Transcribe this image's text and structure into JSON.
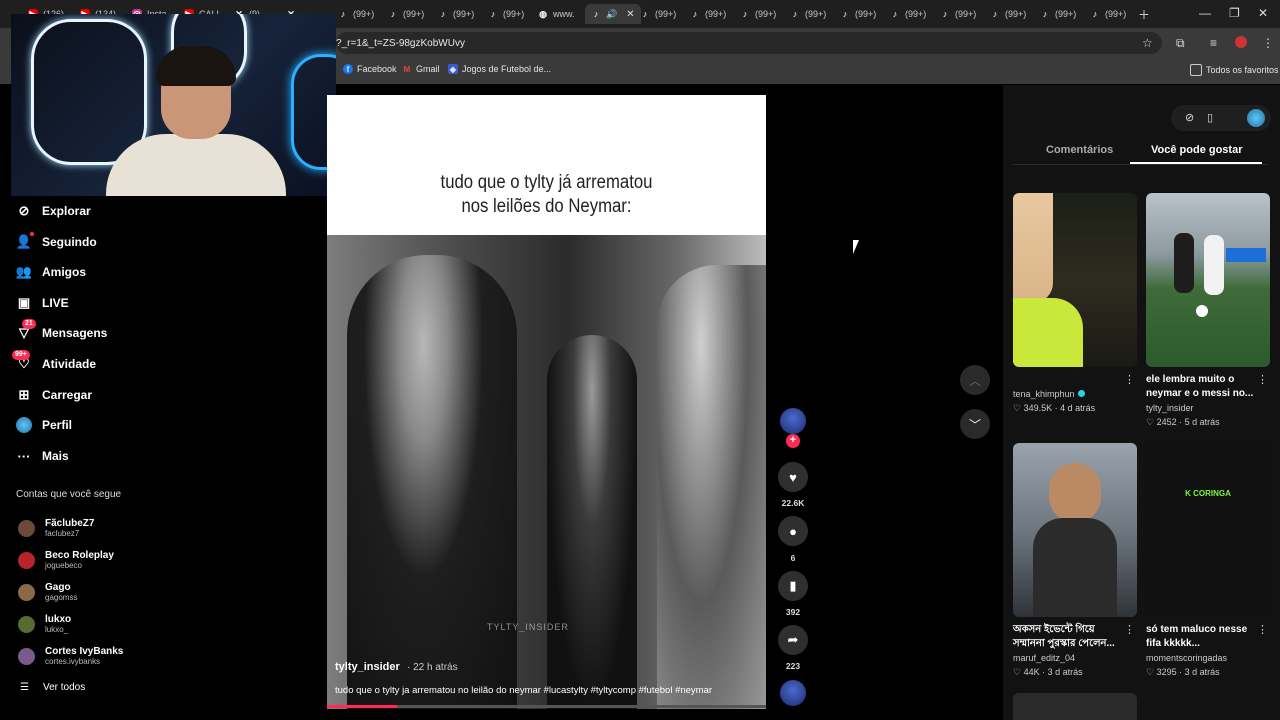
{
  "browser": {
    "tabs": [
      {
        "label": "(126)",
        "icon": "youtube-icon"
      },
      {
        "label": "(134)",
        "icon": "youtube-icon"
      },
      {
        "label": "Insta",
        "icon": "instagram-icon"
      },
      {
        "label": "CALL",
        "icon": "youtube-icon"
      },
      {
        "label": "(9)",
        "icon": "x-icon"
      },
      {
        "label": "(99+)",
        "icon": "tiktok-icon"
      },
      {
        "label": "(99+)",
        "icon": "tiktok-icon"
      },
      {
        "label": "(99+)",
        "icon": "tiktok-icon"
      },
      {
        "label": "(99+)",
        "icon": "tiktok-icon"
      },
      {
        "label": "www.",
        "icon": "globe-icon"
      },
      {
        "label": "(99+)",
        "icon": "tiktok-icon"
      },
      {
        "label": "(99+)",
        "icon": "tiktok-icon"
      },
      {
        "label": "(99+)",
        "icon": "tiktok-icon"
      },
      {
        "label": "(99+)",
        "icon": "tiktok-icon"
      },
      {
        "label": "(99+)",
        "icon": "tiktok-icon"
      },
      {
        "label": "(99+)",
        "icon": "tiktok-icon"
      },
      {
        "label": "(99+)",
        "icon": "tiktok-icon"
      },
      {
        "label": "(99+)",
        "icon": "tiktok-icon"
      },
      {
        "label": "(99+)",
        "icon": "tiktok-icon"
      }
    ],
    "url": "?_r=1&_t=ZS-98gzKobWUvy",
    "bookmarks": [
      {
        "label": "Facebook",
        "icon": "facebook-icon",
        "color": "#1877f2"
      },
      {
        "label": "Gmail",
        "icon": "gmail-icon",
        "color": "#ea4335"
      },
      {
        "label": "Jogos de Futebol de...",
        "icon": "game-icon",
        "color": "#3b5bd6"
      }
    ],
    "all_bookmarks": "Todos os favoritos"
  },
  "sidebar": {
    "nav": [
      {
        "label": "Explorar",
        "icon": "compass-icon",
        "badge": ""
      },
      {
        "label": "Seguindo",
        "icon": "following-icon",
        "badge": ""
      },
      {
        "label": "Amigos",
        "icon": "friends-icon",
        "badge": ""
      },
      {
        "label": "LIVE",
        "icon": "live-icon",
        "badge": ""
      },
      {
        "label": "Mensagens",
        "icon": "messages-icon",
        "badge": "21"
      },
      {
        "label": "Atividade",
        "icon": "activity-icon",
        "badge": "99+"
      },
      {
        "label": "Carregar",
        "icon": "upload-icon",
        "badge": ""
      },
      {
        "label": "Perfil",
        "icon": "profile-icon",
        "badge": ""
      },
      {
        "label": "Mais",
        "icon": "more-icon",
        "badge": ""
      }
    ],
    "following_header": "Contas que você segue",
    "accounts": [
      {
        "name": "FãclubeZ7",
        "handle": "faclubez7",
        "color": "#6a4b3a"
      },
      {
        "name": "Beco Roleplay",
        "handle": "joguebeco",
        "color": "#b8242b"
      },
      {
        "name": "Gago",
        "handle": "gagomss",
        "color": "#8a6a44"
      },
      {
        "name": "lukxo",
        "handle": "lukxo_",
        "color": "#556b2f"
      },
      {
        "name": "Cortes IvyBanks",
        "handle": "cortes.ivybanks",
        "color": "#7a5a8a"
      }
    ],
    "see_all": "Ver todos"
  },
  "video": {
    "caption_line1": "tudo que o tylty já arrematou",
    "caption_line2": "nos leilões do Neymar:",
    "watermark": "TYLTY_INSIDER",
    "author": "tylty_insider",
    "time": "· 22 h atrás",
    "description": "tudo que o tylty ja arrematou no leilão do neymar #lucastylty #tyltycomp #futebol #neymar",
    "progress": 0.16
  },
  "actions": {
    "likes": "22.6K",
    "comments": "6",
    "saves": "392",
    "shares": "223"
  },
  "right_panel": {
    "tabs": [
      "Comentários",
      "Você pode gostar"
    ],
    "active_tab": 1,
    "cards": [
      {
        "title": "",
        "author": "tena_khimphun",
        "verified": true,
        "views": "349.5K",
        "date": "4 d atrás"
      },
      {
        "title": "ele lembra muito o neymar e o messi no...",
        "author": "tylty_insider",
        "verified": false,
        "views": "2452",
        "date": "5 d atrás"
      },
      {
        "title": "অকসন ইভেন্টে গিয়ে সম্মাননা পুরস্কার পেলেন...",
        "author": "maruf_editz_04",
        "verified": false,
        "views": "44K",
        "date": "3 d atrás"
      },
      {
        "title": "só tem maluco nesse fifa kkkkk...",
        "author": "momentscoringadas",
        "verified": false,
        "views": "3295",
        "date": "3 d atrás",
        "thumb_text": "K CORINGA"
      }
    ]
  }
}
